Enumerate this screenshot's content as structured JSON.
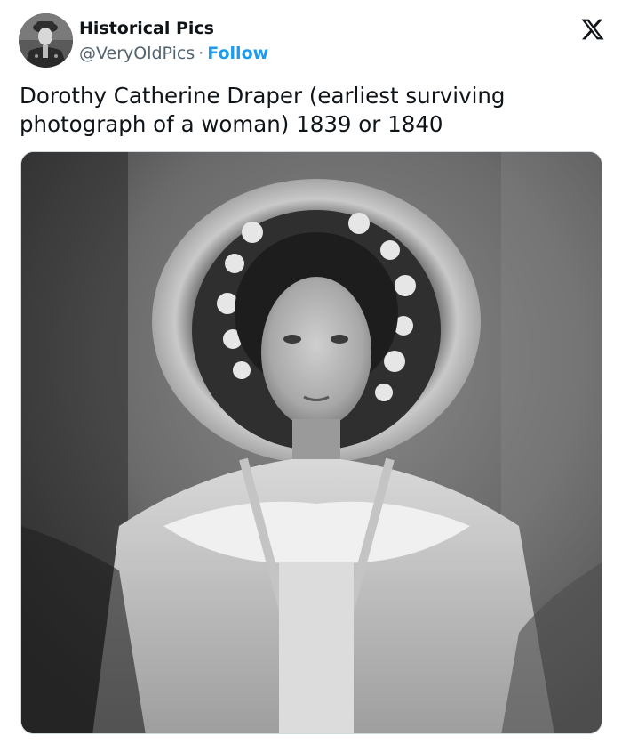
{
  "author": {
    "display_name": "Historical Pics",
    "handle": "@VeryOldPics",
    "separator": "·",
    "follow_label": "Follow"
  },
  "tweet": {
    "text": "Dorothy Catherine Draper (earliest surviving photograph of a woman) 1839 or 1840"
  },
  "icons": {
    "avatar": "avatar-portrait",
    "platform": "x-logo-icon"
  },
  "colors": {
    "text": "#0f1419",
    "secondary": "#536471",
    "accent": "#1d9bf0"
  }
}
